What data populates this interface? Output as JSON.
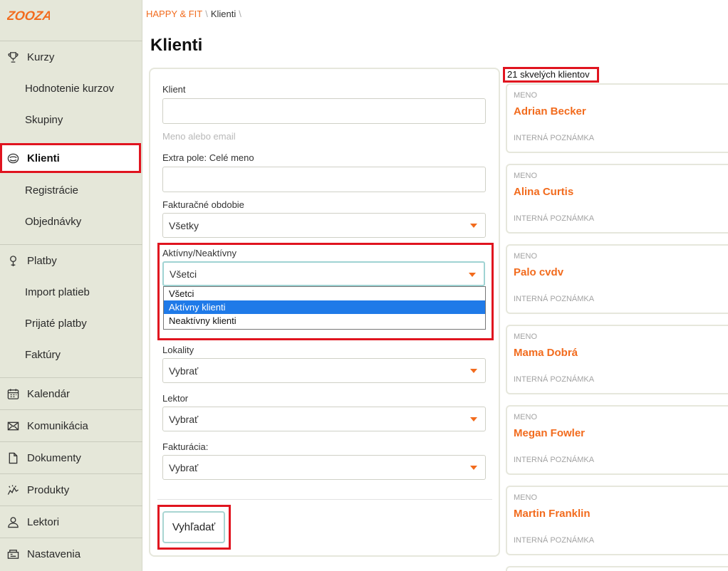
{
  "brand": {
    "logo_text": "ZOOZA",
    "accent": "#f26b1d",
    "highlight_red": "#e0141f"
  },
  "sidebar": {
    "items": [
      {
        "label": "Kurzy",
        "icon": "trophy-icon"
      },
      {
        "label": "Hodnotenie kurzov",
        "icon": ""
      },
      {
        "label": "Skupiny",
        "icon": ""
      },
      {
        "label": "Klienti",
        "icon": "users-icon",
        "active": true
      },
      {
        "label": "Registrácie",
        "icon": ""
      },
      {
        "label": "Objednávky",
        "icon": ""
      },
      {
        "label": "Platby",
        "icon": "money-icon"
      },
      {
        "label": "Import platieb",
        "icon": ""
      },
      {
        "label": "Prijaté platby",
        "icon": ""
      },
      {
        "label": "Faktúry",
        "icon": ""
      },
      {
        "label": "Kalendár",
        "icon": "calendar-icon"
      },
      {
        "label": "Komunikácia",
        "icon": "envelope-icon"
      },
      {
        "label": "Dokumenty",
        "icon": "document-icon"
      },
      {
        "label": "Produkty",
        "icon": "products-icon"
      },
      {
        "label": "Lektori",
        "icon": "person-icon"
      },
      {
        "label": "Nastavenia",
        "icon": "settings-icon"
      }
    ]
  },
  "breadcrumb": {
    "org": "HAPPY & FIT",
    "page": "Klienti",
    "sep": "\\"
  },
  "page_title": "Klienti",
  "filters": {
    "client_label": "Klient",
    "client_value": "",
    "client_hint": "Meno alebo email",
    "extra_label": "Extra pole: Celé meno",
    "extra_value": "",
    "billing_period_label": "Fakturačné obdobie",
    "billing_period_value": "Všetky",
    "active_label": "Aktívny/Neaktívny",
    "active_value": "Všetci",
    "active_options": [
      "Všetci",
      "Aktívny klienti",
      "Neaktívny klienti"
    ],
    "active_highlighted": "Aktívny klienti",
    "locality_label": "Lokality",
    "locality_value": "Vybrať",
    "lector_label": "Lektor",
    "lector_value": "Vybrať",
    "invoicing_label": "Fakturácia:",
    "invoicing_value": "Vybrať",
    "search_button": "Vyhľadať"
  },
  "results": {
    "count_text": "21 skvelých klientov",
    "meno_label": "MENO",
    "note_label": "INTERNÁ POZNÁMKA",
    "clients": [
      "Adrian Becker",
      "Alina Curtis",
      "Palo cvdv",
      "Mama Dobrá",
      "Megan Fowler",
      "Martin Franklin"
    ]
  }
}
